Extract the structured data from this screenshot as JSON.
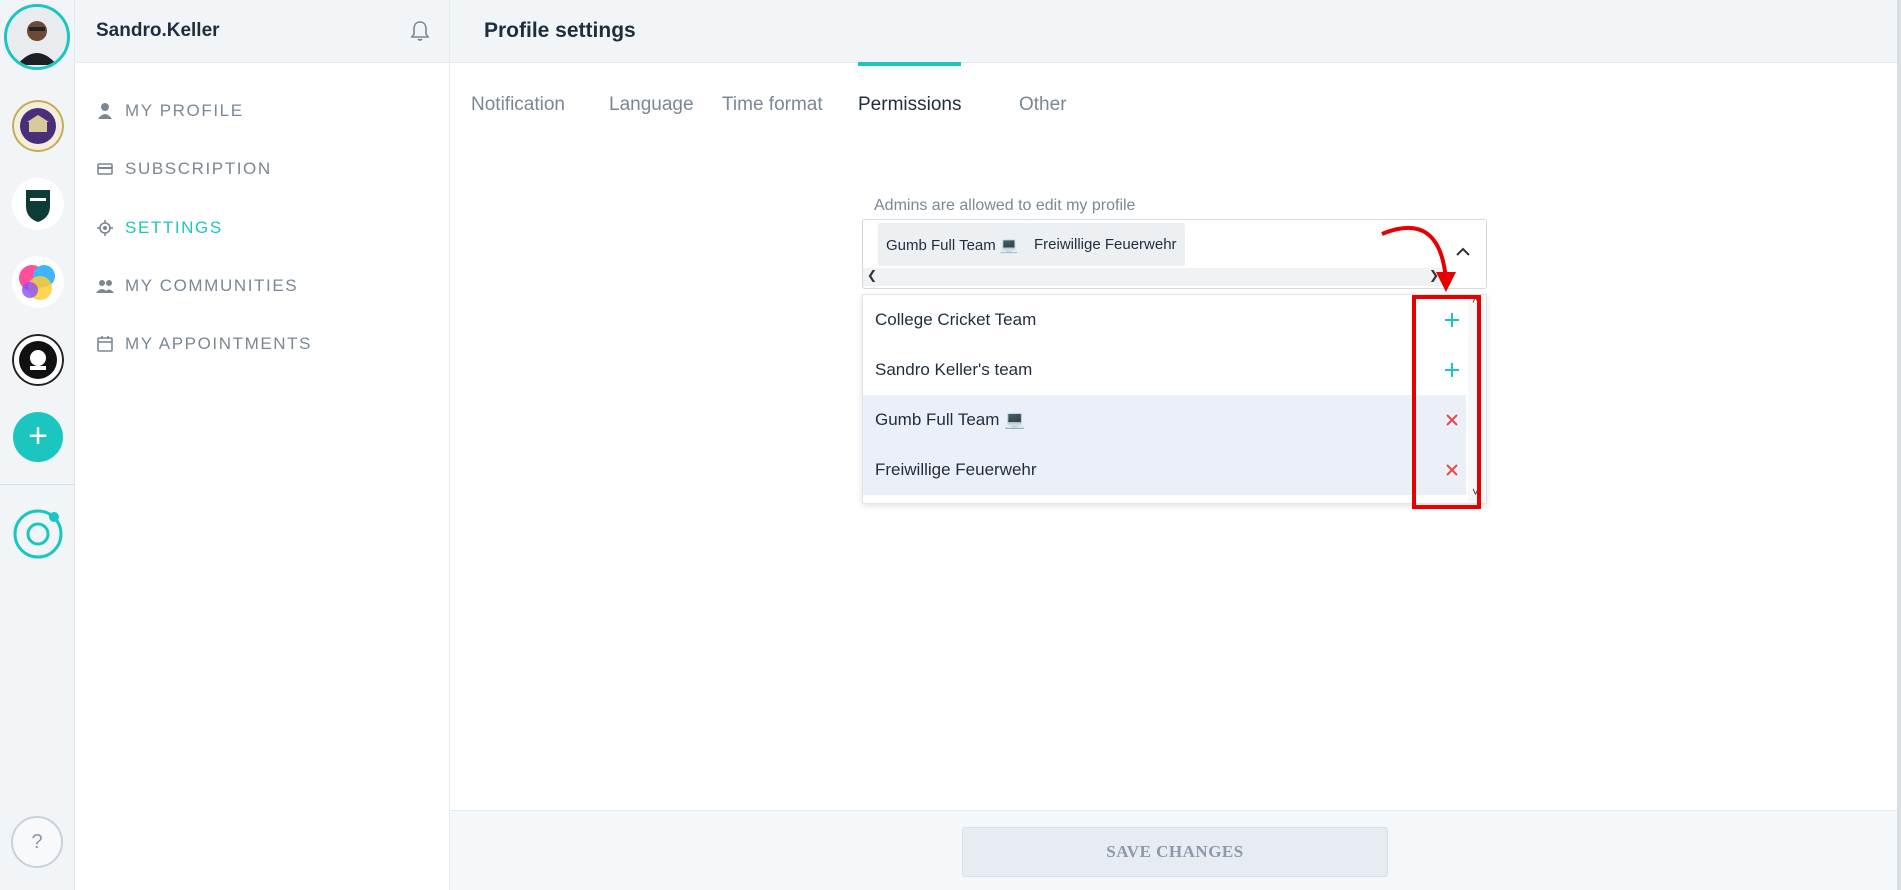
{
  "sidebar": {
    "user_name": "Sandro.Keller",
    "nav": [
      {
        "label": "MY PROFILE",
        "icon": "person-icon"
      },
      {
        "label": "SUBSCRIPTION",
        "icon": "card-icon"
      },
      {
        "label": "SETTINGS",
        "icon": "gear-icon",
        "active": true
      },
      {
        "label": "MY COMMUNITIES",
        "icon": "people-icon"
      },
      {
        "label": "MY APPOINTMENTS",
        "icon": "calendar-icon"
      }
    ]
  },
  "rail": {
    "add_label": "+",
    "help_label": "?"
  },
  "main": {
    "title": "Profile settings",
    "tabs": [
      {
        "label": "Notification"
      },
      {
        "label": "Language"
      },
      {
        "label": "Time format"
      },
      {
        "label": "Permissions",
        "active": true
      },
      {
        "label": "Other"
      }
    ],
    "permissions": {
      "label": "Admins are allowed to edit my profile",
      "selected_chips": [
        "Gumb Full Team 💻",
        "Freiwillige Feuerwehr"
      ],
      "options": [
        {
          "label": "College Cricket Team",
          "selected": false,
          "action": "add"
        },
        {
          "label": "Sandro Keller's team",
          "selected": false,
          "action": "add"
        },
        {
          "label": "Gumb Full Team 💻",
          "selected": true,
          "action": "remove"
        },
        {
          "label": "Freiwillige Feuerwehr",
          "selected": true,
          "action": "remove"
        }
      ]
    },
    "save_label": "SAVE CHANGES"
  },
  "colors": {
    "accent": "#1cc6c0",
    "remove": "#e84a4a",
    "annotation": "#e60000"
  }
}
